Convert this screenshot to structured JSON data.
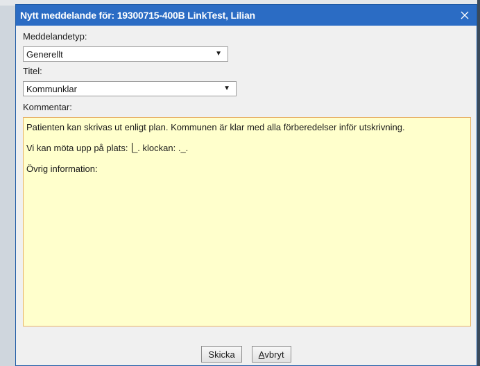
{
  "dialog": {
    "title": "Nytt meddelande för: 19300715-400B LinkTest, Lilian",
    "close_icon": "close-icon"
  },
  "form": {
    "message_type_label": "Meddelandetyp:",
    "message_type_value": "Generellt",
    "title_label": "Titel:",
    "title_value": "Kommunklar",
    "comment_label": "Kommentar:",
    "comment_lines": [
      "Patienten kan skrivas ut enligt plan. Kommunen är klar med alla förberedelser inför utskrivning.",
      "Vi kan möta upp på plats: ",
      "_. klockan: ._.",
      "Övrig information:"
    ]
  },
  "buttons": {
    "send_label": "Skicka",
    "cancel_mnemonic": "A",
    "cancel_rest": "vbryt"
  },
  "colors": {
    "titlebar": "#2b6cc4",
    "comment_bg": "#ffffcc",
    "comment_border": "#e8b36a"
  }
}
